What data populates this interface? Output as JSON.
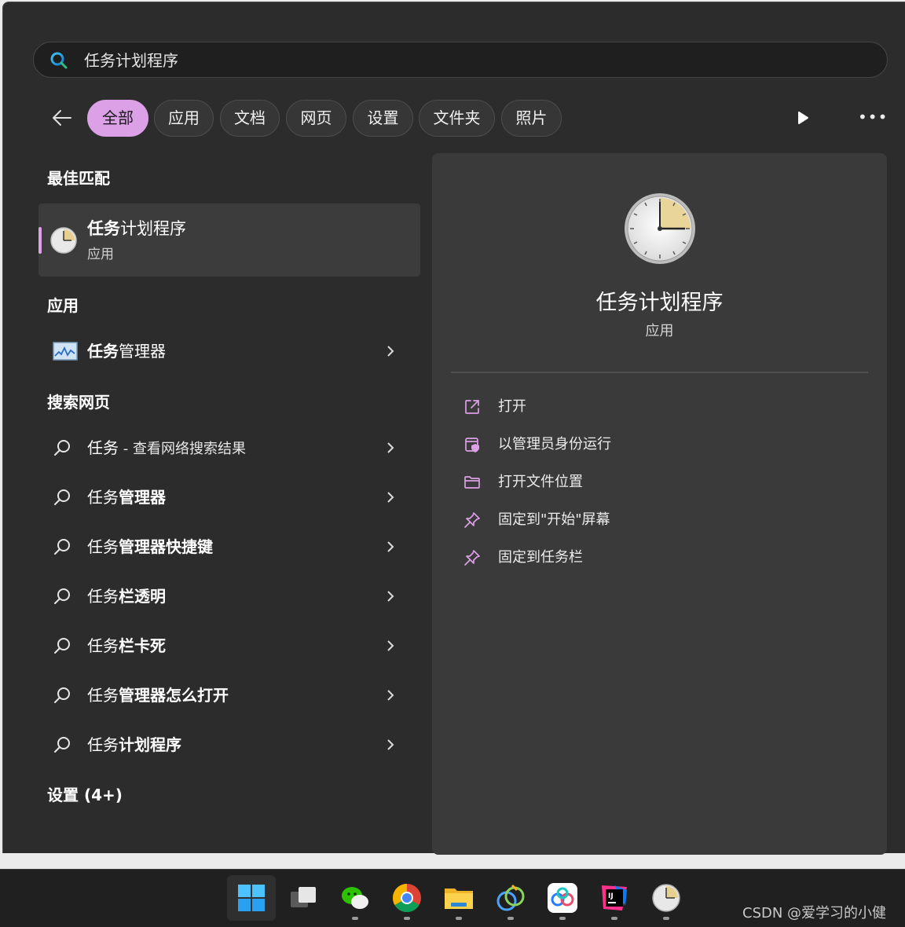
{
  "search": {
    "query": "任务计划程序"
  },
  "filters": [
    {
      "label": "全部",
      "active": true
    },
    {
      "label": "应用"
    },
    {
      "label": "文档"
    },
    {
      "label": "网页"
    },
    {
      "label": "设置"
    },
    {
      "label": "文件夹"
    },
    {
      "label": "照片"
    }
  ],
  "more_label": "•••",
  "best_match": {
    "section": "最佳匹配",
    "name_bold": "任务",
    "name_rest": "计划程序",
    "type": "应用"
  },
  "apps": {
    "section": "应用",
    "item": {
      "bold": "任务",
      "rest": "管理器"
    }
  },
  "web": {
    "section": "搜索网页",
    "items": [
      {
        "prefix": "任务",
        "strong": "",
        "suffix": " - 查看网络搜索结果"
      },
      {
        "prefix": "任务",
        "strong": "管理器",
        "suffix": ""
      },
      {
        "prefix": "任务",
        "strong": "管理器快捷键",
        "suffix": ""
      },
      {
        "prefix": "任务",
        "strong": "栏透明",
        "suffix": ""
      },
      {
        "prefix": "任务",
        "strong": "栏卡死",
        "suffix": ""
      },
      {
        "prefix": "任务",
        "strong": "管理器怎么打开",
        "suffix": ""
      },
      {
        "prefix": "任务",
        "strong": "计划程序",
        "suffix": ""
      }
    ]
  },
  "settings_section": "设置 (4+)",
  "detail": {
    "title": "任务计划程序",
    "subtitle": "应用",
    "actions": [
      {
        "label": "打开",
        "icon": "open-external-icon"
      },
      {
        "label": "以管理员身份运行",
        "icon": "run-as-admin-icon"
      },
      {
        "label": "打开文件位置",
        "icon": "folder-icon"
      },
      {
        "label": "固定到\"开始\"屏幕",
        "icon": "pin-icon"
      },
      {
        "label": "固定到任务栏",
        "icon": "pin-icon"
      }
    ]
  },
  "colors": {
    "accent": "#dca0e6",
    "panel": "#2c2c2c",
    "detail": "#3a3a3a"
  },
  "watermark": "CSDN @爱学习的小健"
}
